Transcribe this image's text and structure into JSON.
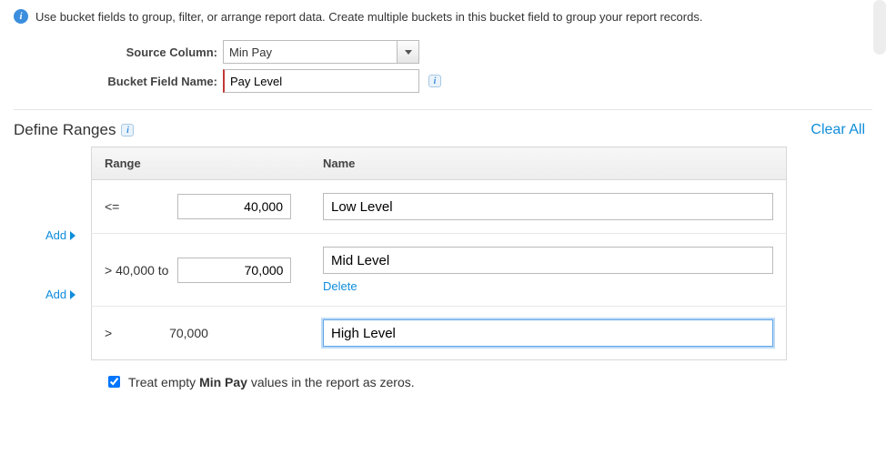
{
  "info": {
    "text": "Use bucket fields to group, filter, or arrange report data. Create multiple buckets in this bucket field to group your report records."
  },
  "form": {
    "source_column_label": "Source Column:",
    "source_column_value": "Min Pay",
    "bucket_field_name_label": "Bucket Field Name:",
    "bucket_field_name_value": "Pay Level"
  },
  "section": {
    "title": "Define Ranges",
    "clear_all": "Clear All"
  },
  "table": {
    "headers": {
      "range": "Range",
      "name": "Name"
    },
    "rows": [
      {
        "op": "<=",
        "value": "40,000",
        "value_editable": true,
        "name": "Low Level",
        "show_delete": false,
        "focused": false
      },
      {
        "op": "> 40,000 to",
        "value": "70,000",
        "value_editable": true,
        "name": "Mid Level",
        "show_delete": true,
        "focused": false
      },
      {
        "op": ">",
        "value": "70,000",
        "value_editable": false,
        "name": "High Level",
        "show_delete": false,
        "focused": true
      }
    ],
    "delete_label": "Delete"
  },
  "add_label": "Add",
  "treat_empty": {
    "checked": true,
    "pre": "Treat empty ",
    "bold": "Min Pay",
    "post": " values in the report as zeros."
  }
}
